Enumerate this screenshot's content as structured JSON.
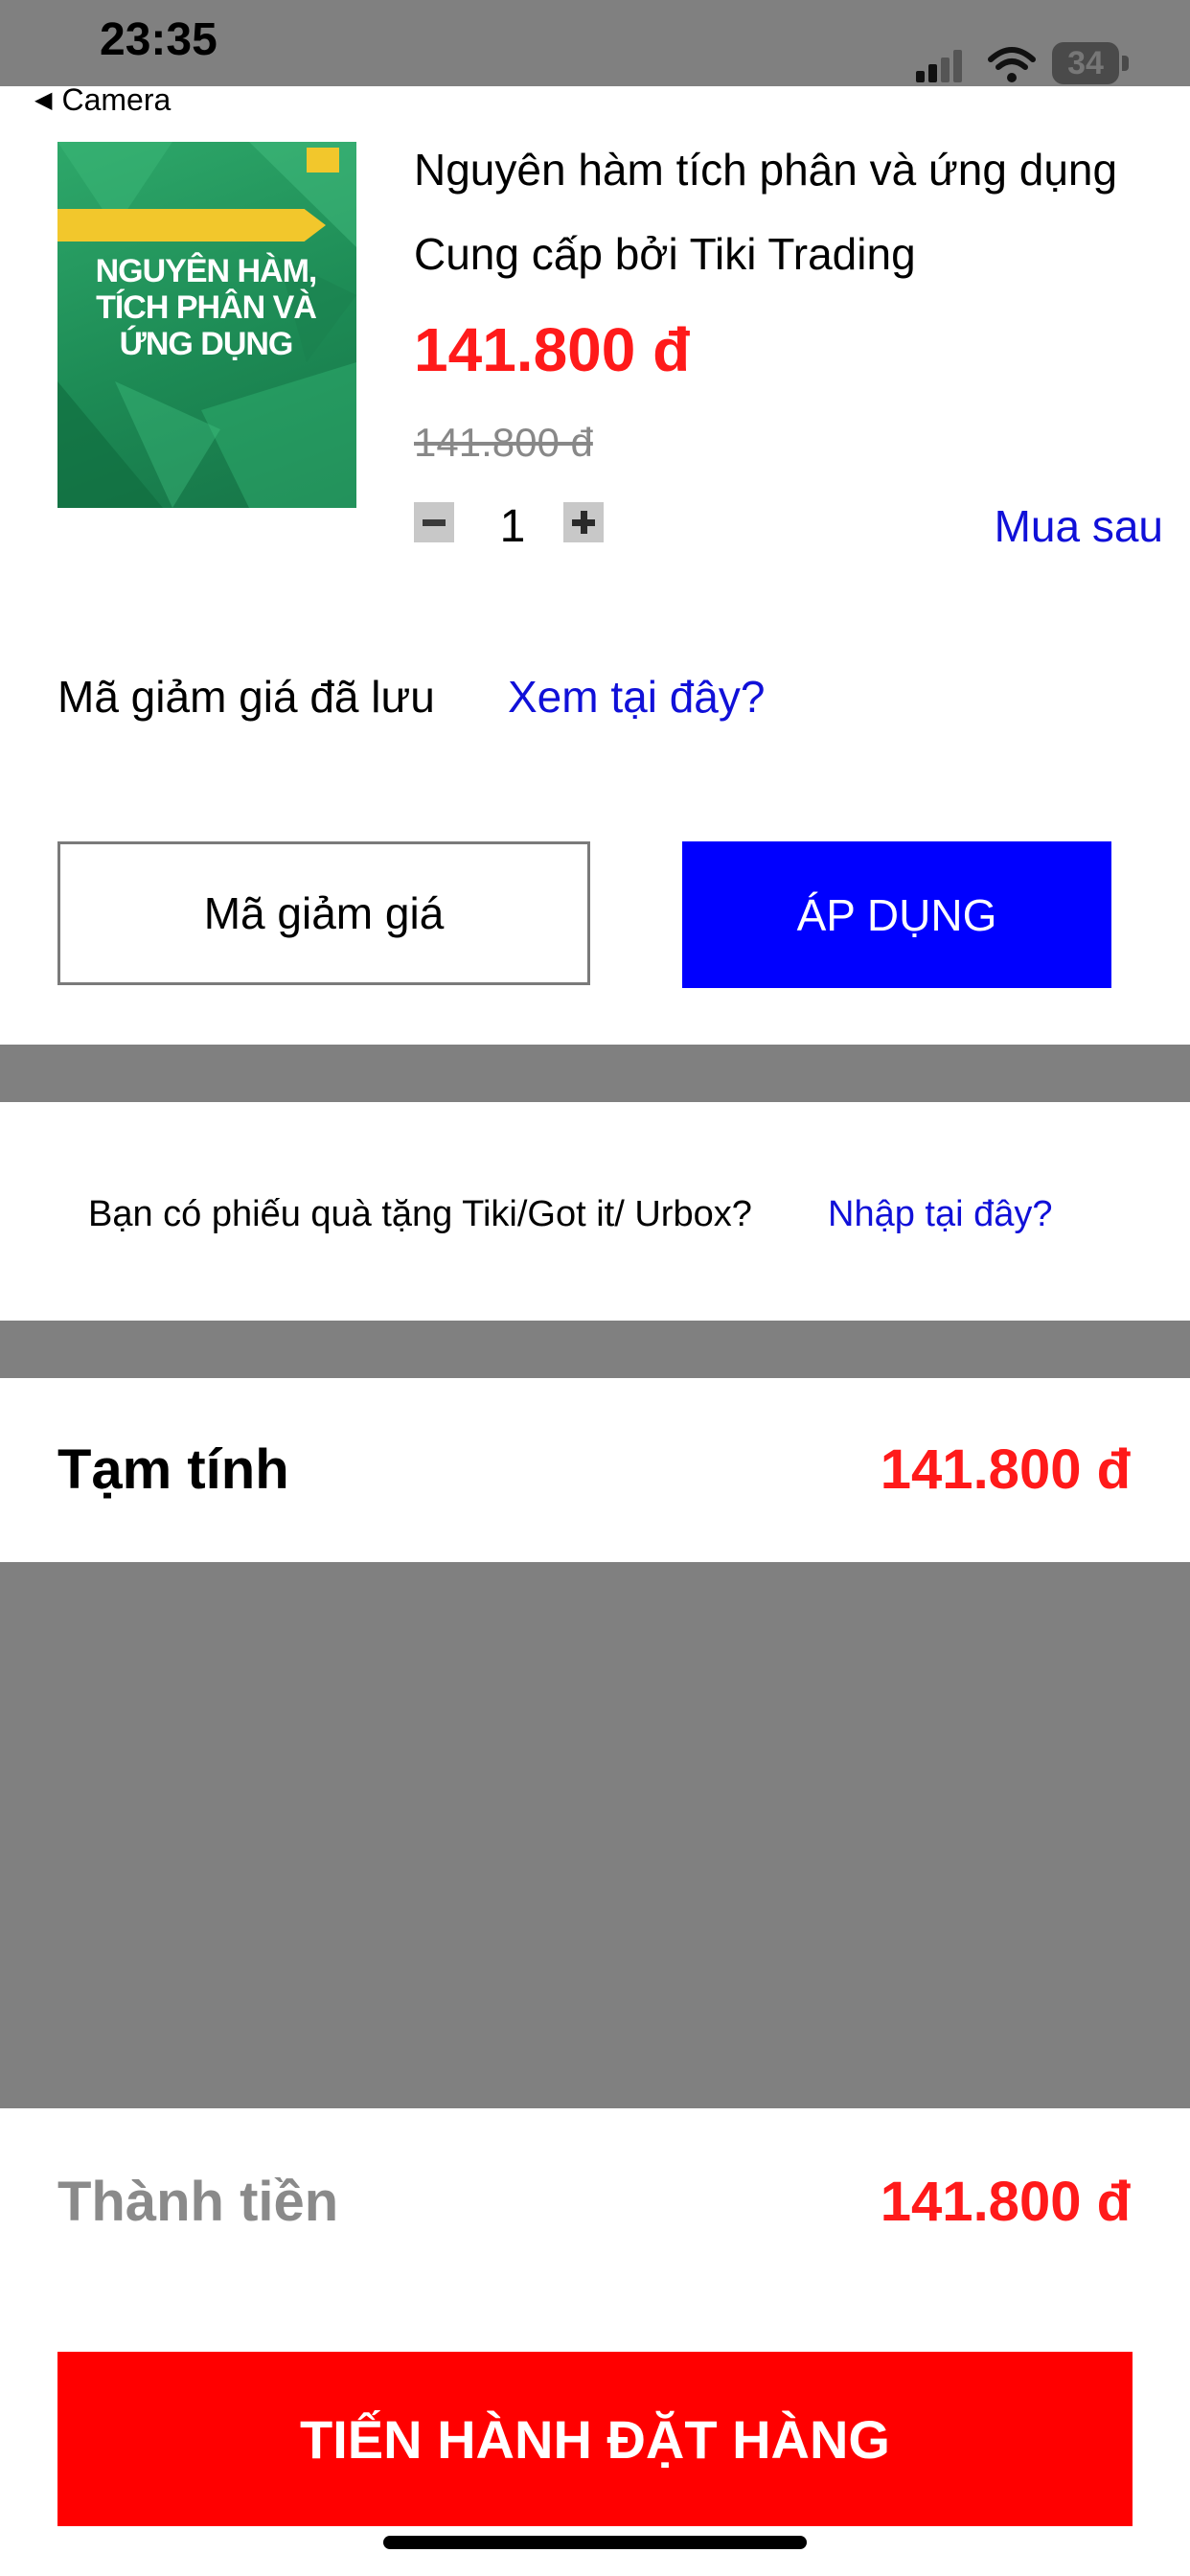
{
  "status_bar": {
    "time": "23:35",
    "battery": "34",
    "icons": [
      "signal-icon",
      "wifi-icon",
      "battery-icon"
    ]
  },
  "nav": {
    "back_label": "Camera"
  },
  "product": {
    "cover_title": "NGUYÊN HÀM, TÍCH PHÂN VÀ ỨNG DỤNG",
    "title": "Nguyên hàm tích phân và ứng dụng",
    "seller": "Cung cấp bởi Tiki Trading",
    "price": "141.800 đ",
    "old_price": "141.800 đ",
    "quantity": "1",
    "buy_later": "Mua sau"
  },
  "coupon": {
    "saved_label": "Mã giảm giá đã lưu",
    "saved_link": "Xem tại đây?",
    "input_placeholder": "Mã giảm giá",
    "apply_label": "ÁP DỤNG"
  },
  "gift": {
    "question": "Bạn có phiếu quà tặng Tiki/Got it/ Urbox?",
    "link": "Nhập tại đây?"
  },
  "summary": {
    "subtotal_label": "Tạm tính",
    "subtotal_value": "141.800 đ",
    "total_label": "Thành tiền",
    "total_value": "141.800 đ"
  },
  "checkout": {
    "label": "TIẾN HÀNH ĐẶT HÀNG"
  },
  "colors": {
    "accent_red": "#ff1a1a",
    "link_blue": "#1010d8",
    "apply_blue": "#0000ff",
    "divider_gray": "#808080"
  }
}
